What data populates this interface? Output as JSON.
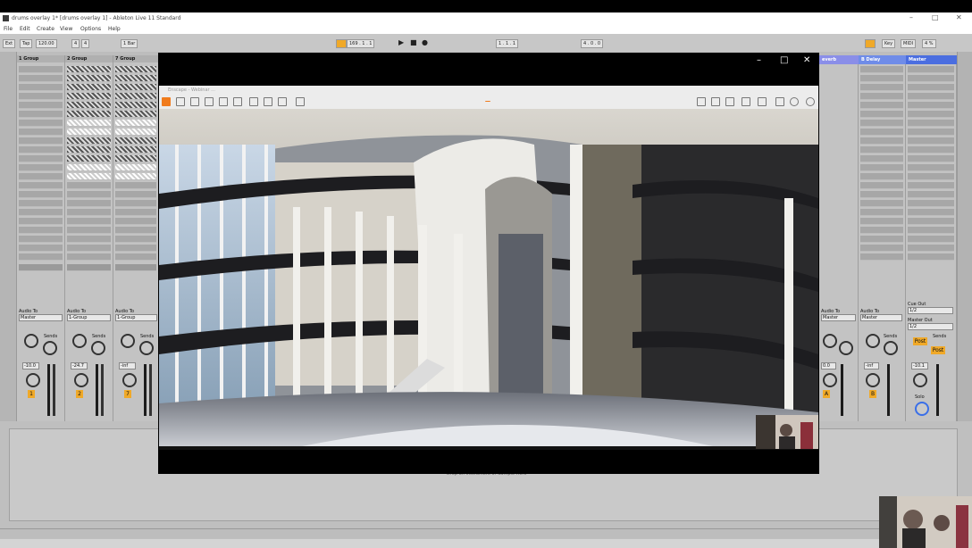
{
  "ableton": {
    "window_title": "drums overlay 1* [drums overlay 1] - Ableton Live 11 Standard",
    "menu": [
      "File",
      "Edit",
      "Create",
      "View",
      "Options",
      "Help"
    ],
    "control_bar": {
      "ext": "Ext",
      "tap": "Tap",
      "tempo": "120.00",
      "signature_num": "4",
      "signature_den": "4",
      "quantize": "1 Bar",
      "position": "169 . 1 . 1",
      "loop_start": "1 . 1 . 1",
      "loop_length": "4 . 0 . 0",
      "key": "Key",
      "midi": "MIDI",
      "cpu": "4 %"
    },
    "tracks": [
      {
        "name": "1 Group",
        "audio_to": "Audio To",
        "dest": "Master",
        "volume": "-10.0",
        "number": "1"
      },
      {
        "name": "2 Group",
        "audio_to": "Audio To",
        "dest": "1-Group",
        "volume": "-24.7",
        "number": "2"
      },
      {
        "name": "7 Group",
        "audio_to": "Audio To",
        "dest": "1-Group",
        "volume": "-inf",
        "number": "7"
      }
    ],
    "right_tracks": [
      {
        "name": "everb",
        "audio_to": "Audio To",
        "dest": "Master",
        "volume": "0.0",
        "number": "A"
      },
      {
        "name": "B Delay",
        "audio_to": "Audio To",
        "dest": "Master",
        "volume": "-inf",
        "number": "B"
      },
      {
        "name": "Master",
        "cue_out": "Cue Out",
        "cue_value": "1/2",
        "master_out": "Master Out",
        "master_value": "1/2",
        "volume": "-10.1"
      }
    ],
    "sends_label": "Sends",
    "post_label": "Post",
    "solo_label": "Solo",
    "detail_hint": "Drop an Instrument or Sample Here"
  },
  "viewer": {
    "app_title": "Enscape - Webinar ...",
    "close": "✕",
    "maximize": "□",
    "minimize": "–"
  },
  "colors": {
    "ableton_accent": "#f0a928",
    "group_header": "#b0b0b0",
    "reverb_header": "#8a8ee8",
    "delay_header": "#6f8ce8",
    "master_header": "#4b6ee0",
    "enscape_logo": "#f07b1c"
  }
}
